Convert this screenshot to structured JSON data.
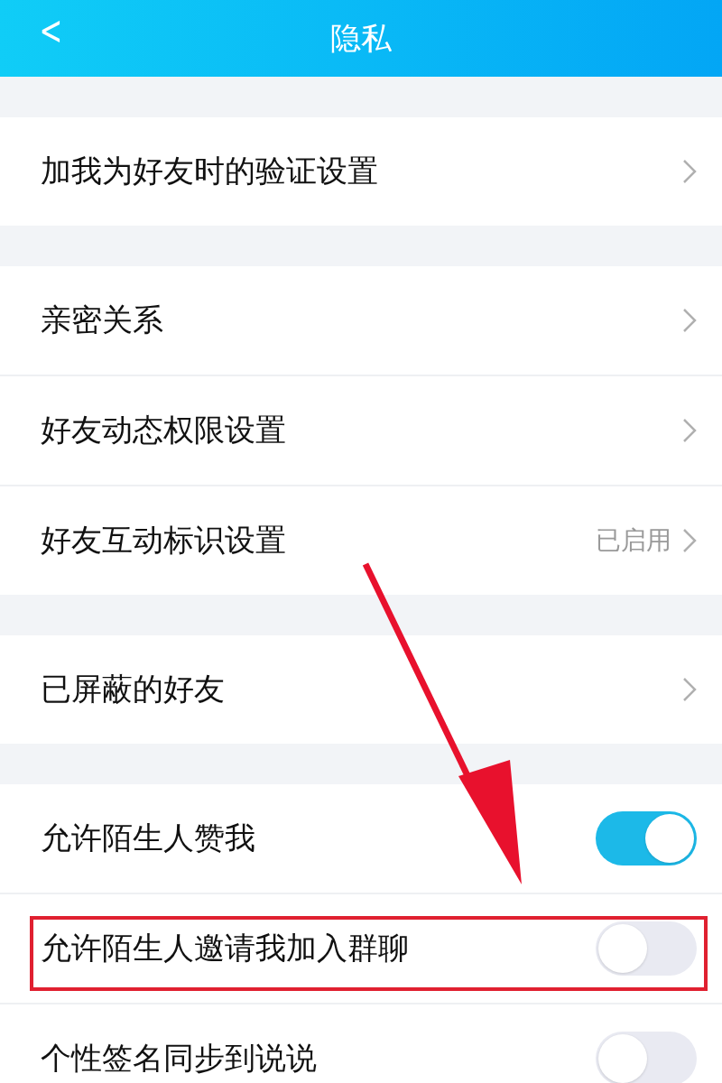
{
  "header": {
    "back": "<",
    "title": "隐私"
  },
  "sections": [
    {
      "rows": [
        {
          "kind": "link",
          "label": "加我为好友时的验证设置",
          "boxed": false
        }
      ]
    },
    {
      "rows": [
        {
          "kind": "link",
          "label": "亲密关系",
          "boxed": false
        },
        {
          "kind": "link",
          "label": "好友动态权限设置",
          "boxed": false
        },
        {
          "kind": "link",
          "label": "好友互动标识设置",
          "value": "已启用",
          "boxed": false
        }
      ]
    },
    {
      "rows": [
        {
          "kind": "link",
          "label": "已屏蔽的好友",
          "boxed": false
        }
      ]
    },
    {
      "rows": [
        {
          "kind": "toggle",
          "label": "允许陌生人赞我",
          "on": true,
          "boxed": false
        },
        {
          "kind": "toggle",
          "label": "允许陌生人邀请我加入群聊",
          "on": false,
          "boxed": true
        },
        {
          "kind": "toggle",
          "label": "个性签名同步到说说",
          "on": false,
          "boxed": false
        }
      ]
    }
  ]
}
